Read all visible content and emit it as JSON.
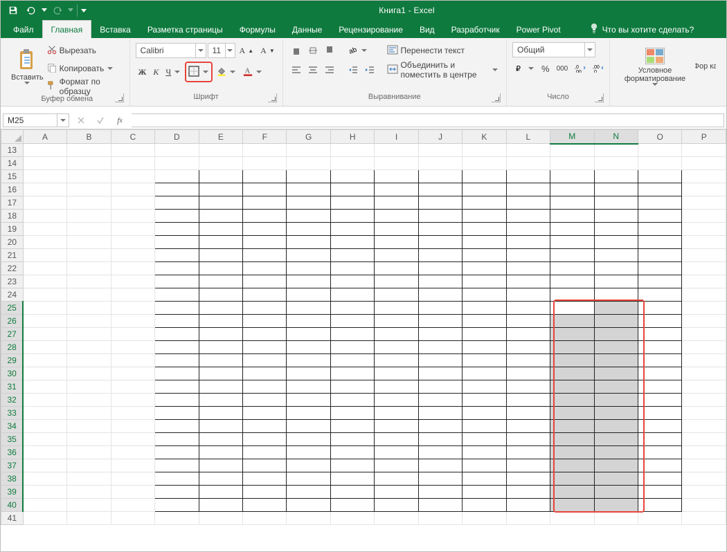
{
  "app": {
    "title": "Книга1 - Excel"
  },
  "qat": {
    "save": "save-icon",
    "undo": "undo-icon",
    "redo": "redo-icon"
  },
  "tabs": {
    "items": [
      {
        "label": "Файл"
      },
      {
        "label": "Главная"
      },
      {
        "label": "Вставка"
      },
      {
        "label": "Разметка страницы"
      },
      {
        "label": "Формулы"
      },
      {
        "label": "Данные"
      },
      {
        "label": "Рецензирование"
      },
      {
        "label": "Вид"
      },
      {
        "label": "Разработчик"
      },
      {
        "label": "Power Pivot"
      }
    ],
    "active_index": 1,
    "tell_me": "Что вы хотите сделать?"
  },
  "ribbon": {
    "clipboard": {
      "label": "Буфер обмена",
      "paste": "Вставить",
      "cut": "Вырезать",
      "copy": "Копировать",
      "format_painter": "Формат по образцу"
    },
    "font": {
      "label": "Шрифт",
      "name": "Calibri",
      "size": "11"
    },
    "alignment": {
      "label": "Выравнивание",
      "wrap": "Перенести текст",
      "merge": "Объединить и поместить в центре"
    },
    "number": {
      "label": "Число",
      "format": "Общий"
    },
    "styles": {
      "cond_format": "Условное форматирование",
      "format_as": "Фор ка"
    }
  },
  "namebox": {
    "value": "M25"
  },
  "grid": {
    "columns": [
      "A",
      "B",
      "C",
      "D",
      "E",
      "F",
      "G",
      "H",
      "I",
      "J",
      "K",
      "L",
      "M",
      "N",
      "O",
      "P"
    ],
    "first_row": 13,
    "last_row": 41,
    "bordered_cols_from": "D",
    "bordered_cols_to": "O",
    "bordered_rows_from": 15,
    "bordered_rows_to": 40,
    "selection": {
      "cols_from": "M",
      "cols_to": "N",
      "rows_from": 25,
      "rows_to": 40,
      "active": "M25"
    }
  }
}
